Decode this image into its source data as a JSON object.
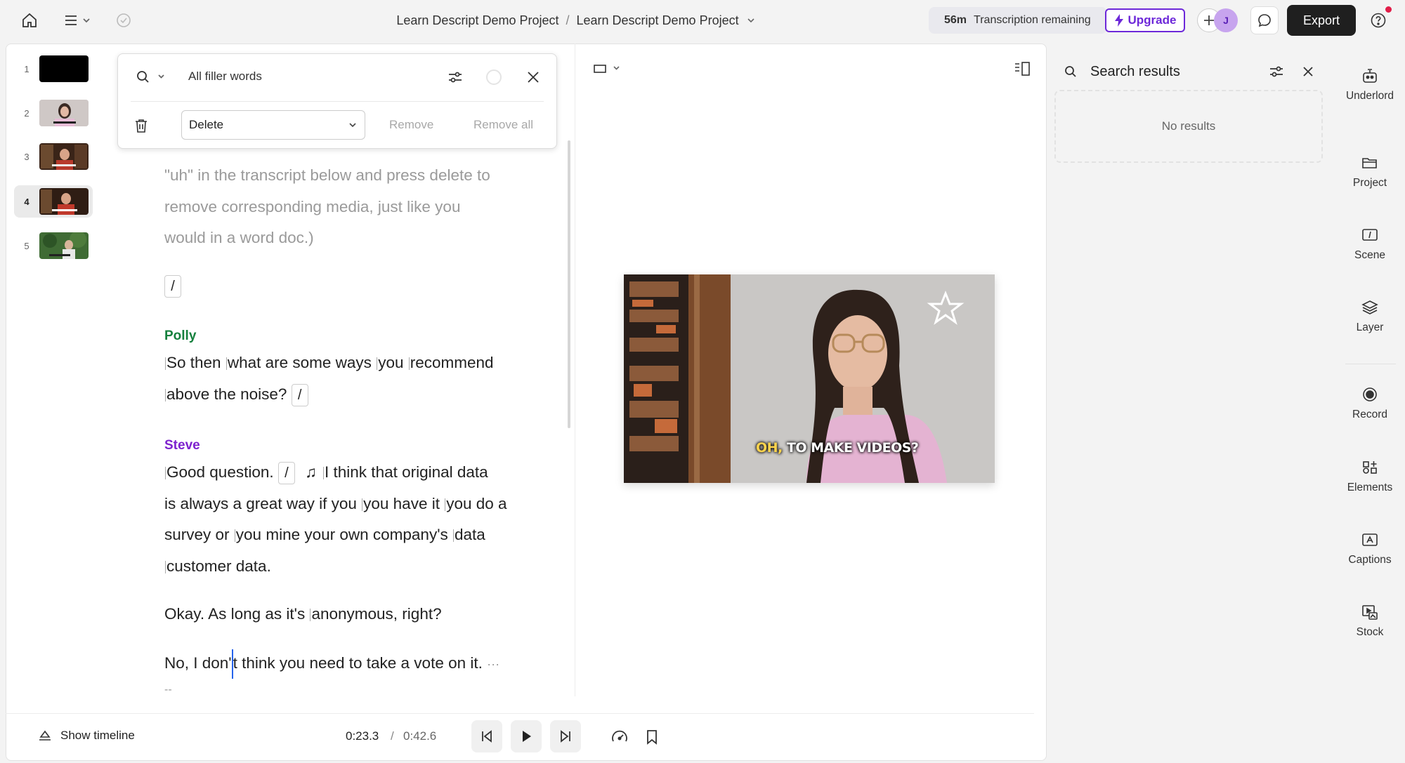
{
  "header": {
    "breadcrumb_1": "Learn Descript Demo Project",
    "breadcrumb_sep": "/",
    "breadcrumb_2": "Learn Descript Demo Project",
    "transcription_minutes": "56m",
    "transcription_label": "Transcription remaining",
    "upgrade_label": "Upgrade",
    "avatar_initial": "J",
    "export_label": "Export"
  },
  "scenes": [
    {
      "number": "1"
    },
    {
      "number": "2"
    },
    {
      "number": "3"
    },
    {
      "number": "4"
    },
    {
      "number": "5"
    }
  ],
  "search": {
    "query": "All filler words",
    "action": "Delete",
    "remove_label": "Remove",
    "remove_all_label": "Remove all"
  },
  "transcript": {
    "intro_line_1": "\"uh\" in the transcript below and press delete to",
    "intro_line_2": "remove corresponding media, just like you",
    "intro_line_3": "would in a word doc.)",
    "gap_mark": "/",
    "music_mark": "♫",
    "speaker_1": "Polly",
    "polly_a": "So then",
    "polly_b": "what are some ways",
    "polly_c": "you",
    "polly_d": "recommend",
    "polly_e": "above the noise?",
    "speaker_2": "Steve",
    "steve_a": "Good question.",
    "steve_b": "I think that original data",
    "steve_c": "is always a great way if you",
    "steve_d": "you have it",
    "steve_e": "you do a",
    "steve_f": "survey or",
    "steve_g": "you mine your own company's",
    "steve_h": "data",
    "steve_i": "customer data.",
    "line_2a": "Okay. As long as it's",
    "line_2b": "anonymous, right?",
    "line_3a": "No, I don'",
    "line_3b": "t",
    "line_3c": "think you need to take a vote on it.",
    "ellipsis": "···",
    "trailing": "--"
  },
  "video": {
    "caption_highlight": "OH,",
    "caption_rest": "TO MAKE VIDEOS?"
  },
  "playback": {
    "current_time": "0:23.3",
    "separator": "/",
    "total_time": "0:42.6",
    "show_timeline_label": "Show timeline"
  },
  "results_panel": {
    "title": "Search results",
    "empty_text": "No results"
  },
  "rail": {
    "underlord": "Underlord",
    "project": "Project",
    "scene": "Scene",
    "layer": "Layer",
    "record": "Record",
    "elements": "Elements",
    "captions": "Captions",
    "stock": "Stock"
  },
  "colors": {
    "accent_purple": "#6d28d9",
    "polly_green": "#15803d",
    "steve_purple": "#7e22ce",
    "cursor_blue": "#2563eb"
  }
}
